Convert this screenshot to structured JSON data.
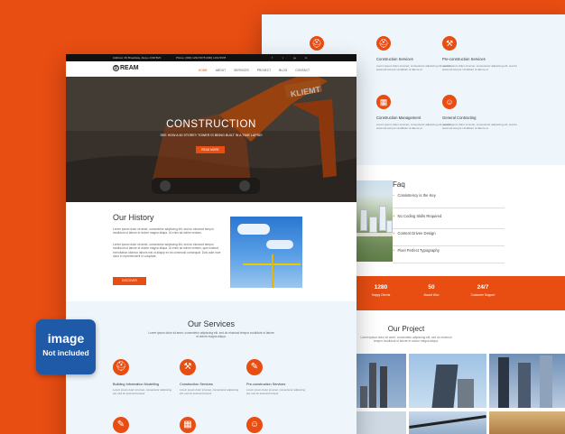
{
  "colors": {
    "accent": "#e84d12",
    "background": "#e84d12",
    "badge": "#1e5aa8"
  },
  "back": {
    "services_top": [
      {
        "title": "Construction Services",
        "icon": "helmet-icon",
        "desc": "Lorem ipsum dolor sit amet, consectetur adipiscing elit, sed do eiusmod tempor incididunt ut labore et"
      },
      {
        "title": "Pre-construction Services",
        "icon": "hammer-icon",
        "desc": "Lorem ipsum dolor sit amet, consectetur adipiscing elit, sed do eiusmod tempor incididunt ut labore et"
      },
      {
        "title": "Construction Management",
        "icon": "building-icon",
        "desc": "Lorem ipsum dolor sit amet, consectetur adipiscing elit, sed do eiusmod tempor incididunt ut labore et"
      },
      {
        "title": "General Contracting",
        "icon": "users-icon",
        "desc": "Lorem ipsum dolor sit amet, consectetur adipiscing elit, sed do eiusmod tempor incididunt ut labore et"
      }
    ],
    "faq": {
      "title": "Faq",
      "items": [
        "Consistency is the Key",
        "No Coding Skills Required",
        "Content Driven Design",
        "Pixel Perfect Typography"
      ]
    },
    "stats": [
      {
        "value": "1280",
        "label": "Happy Clients"
      },
      {
        "value": "50",
        "label": "Award Won"
      },
      {
        "value": "24/7",
        "label": "Customer Support"
      }
    ],
    "project": {
      "title": "Our Project",
      "subtitle": "Lorem ipsum dolor sit amet, consectetur adipiscing elit, sed do eiusmod tempor incididunt ut labore et dolore magna aliqua."
    }
  },
  "front": {
    "topbar": {
      "address": "Address: 60 Broadway, Aksyo Jl.98 BVF",
      "phone": "Phone: (000) 1234 5678 (000) 1234 5678",
      "socials": [
        "f",
        "t",
        "g+",
        "in"
      ]
    },
    "logo": "REAM",
    "logo_initial": "D",
    "nav": [
      "HOME",
      "ABOUT",
      "SERVICES",
      "PROJECT",
      "BLOG",
      "CONTACT"
    ],
    "hero": {
      "title": "CONSTRUCTION",
      "subtitle": "SEE HOW A 60 STOREY TOWER IS BEING BUILT IN A TIME LAPSE!",
      "button": "READ MORE",
      "machine_text": "KLIEMT"
    },
    "history": {
      "title": "Our History",
      "p1": "Lorem ipsum dolor sit amet, consectetur adipiscing elit, sed do eiusmod tempor incididunt ut labore et dolore magna aliqua. Ut enim ad minim veniam.",
      "p2": "Lorem ipsum dolor sit amet, consectetur adipiscing elit, sed do eiusmod tempor incididunt ut labore et dolore magna aliqua. Ut enim ad minim veniam, quis nostrud exercitation ullamco laboris nisi ut aliquip ex ea commodo consequat. Duis aute irure dolor in reprehenderit in voluptate.",
      "button": "DISCOVER"
    },
    "services": {
      "title": "Our Services",
      "subtitle": "Lorem ipsum dolor sit amet, consectetur adipiscing elit, sed do eiusmod tempor incididunt ut labore et dolore magna aliqua.",
      "items": [
        {
          "title": "Building Information Modelling",
          "icon": "helmet-icon",
          "desc": "Lorem ipsum dolor sit amet, consectetur adipiscing elit, sed do eiusmod tempor"
        },
        {
          "title": "Construction Services",
          "icon": "hammer-icon",
          "desc": "Lorem ipsum dolor sit amet, consectetur adipiscing elit, sed do eiusmod tempor"
        },
        {
          "title": "Pre-construction Services",
          "icon": "tools-icon",
          "desc": "Lorem ipsum dolor sit amet, consectetur adipiscing elit, sed do eiusmod tempor"
        }
      ]
    }
  },
  "badge": {
    "line1": "image",
    "line2": "Not included"
  }
}
